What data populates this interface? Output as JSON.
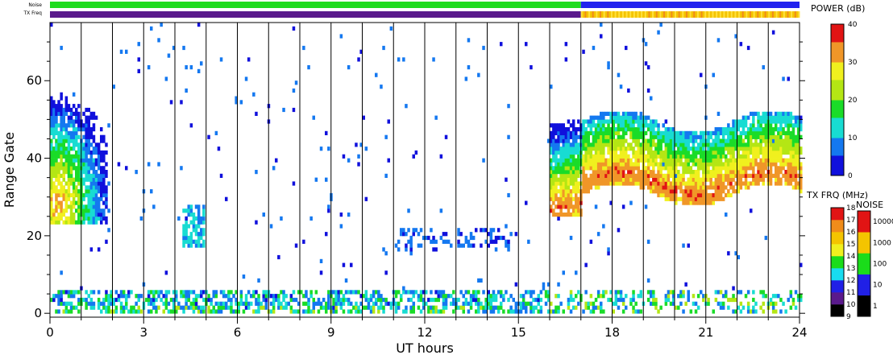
{
  "chart_data": {
    "type": "heatmap",
    "xlabel": "UT hours",
    "ylabel": "Range Gate",
    "x_ticks": [
      "0",
      "3",
      "6",
      "9",
      "12",
      "15",
      "18",
      "21",
      "24"
    ],
    "y_ticks": [
      "0",
      "20",
      "40",
      "60"
    ],
    "xlim": [
      0,
      24
    ],
    "ylim": [
      -1,
      75
    ],
    "hour_gridlines": [
      1,
      2,
      3,
      4,
      5,
      6,
      7,
      8,
      9,
      10,
      11,
      12,
      13,
      14,
      15,
      16,
      17,
      18,
      19,
      20,
      21,
      22,
      23,
      24
    ],
    "strip_labels": {
      "noise": "Noise",
      "tx_freq": "TX Freq"
    },
    "noise_strip": [
      {
        "from": 0,
        "to": 17,
        "color": "#1fdc1f"
      },
      {
        "from": 17,
        "to": 24,
        "color": "#2222ee"
      }
    ],
    "txfreq_strip": [
      {
        "from": 0,
        "to": 17,
        "color": "#5a1a8c"
      },
      {
        "from": 17,
        "to": 24,
        "color": "#f4c400"
      }
    ],
    "features": [
      {
        "t0": 0.0,
        "t1": 1.8,
        "r0": 22,
        "r1": 56,
        "peak_center": [
          0.2,
          28
        ],
        "peak": 30
      },
      {
        "t0": 16.0,
        "t1": 24.0,
        "r0": 25,
        "r1": 62,
        "peak_band": "tracking ~27-36",
        "peak": 32
      },
      {
        "t0": 4.2,
        "t1": 4.9,
        "r0": 16,
        "r1": 28,
        "peak": 12
      },
      {
        "t0": 0.0,
        "t1": 16.0,
        "r0": 0,
        "r1": 6,
        "peak": 20
      },
      {
        "t0": 11.0,
        "t1": 15.0,
        "r0": 15,
        "r1": 22,
        "peak": 8
      }
    ],
    "colorbars": [
      {
        "title": "POWER (dB)",
        "ticks": [
          "0",
          "10",
          "20",
          "30",
          "40"
        ],
        "range": [
          0,
          40
        ],
        "colors": [
          "#1010dc",
          "#1478f0",
          "#18dcd2",
          "#1adc28",
          "#b4e614",
          "#f0f01e",
          "#f09628",
          "#e11414"
        ]
      },
      {
        "title": "TX FRQ (MHz)",
        "ticks": [
          "9",
          "10",
          "11",
          "12",
          "13",
          "14",
          "15",
          "16",
          "17",
          "18"
        ],
        "colors": [
          "#000000",
          "#5a1a8c",
          "#2020e6",
          "#18dcf0",
          "#1adc1a",
          "#f0f01e",
          "#f4c400",
          "#f08c1a",
          "#e11414"
        ]
      },
      {
        "title": "NOISE",
        "ticks": [
          "1",
          "10",
          "100",
          "1000",
          "10000"
        ],
        "colors": [
          "#000000",
          "#2020e6",
          "#1adc1a",
          "#f4c400",
          "#e11414"
        ]
      }
    ]
  }
}
